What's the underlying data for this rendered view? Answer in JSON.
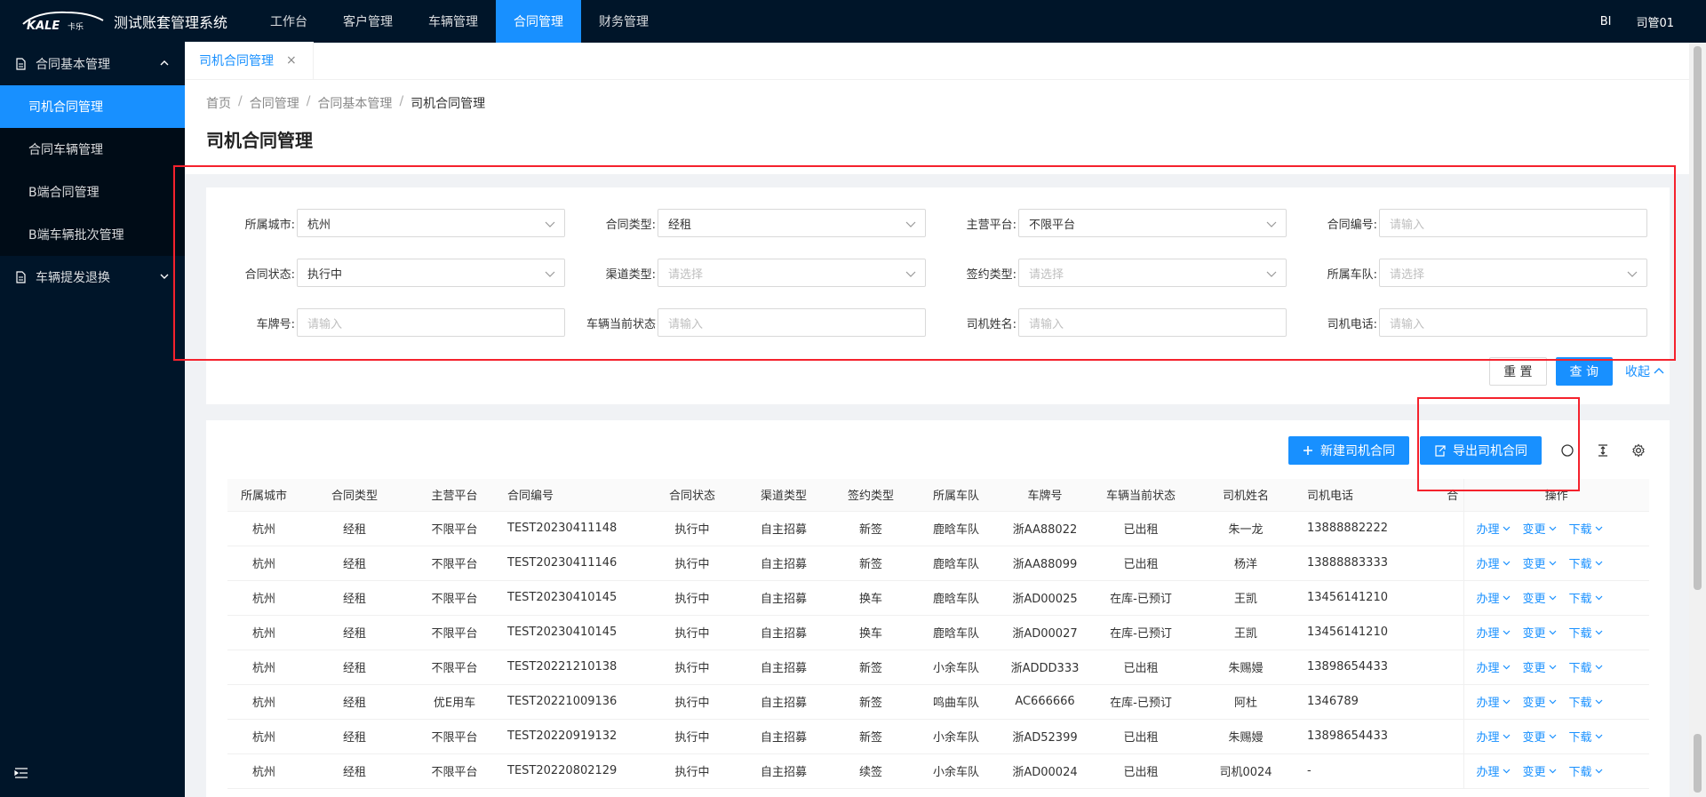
{
  "app": {
    "logo_text": "KALE卡乐",
    "title": "测试账套管理系统"
  },
  "topnav": [
    {
      "label": "工作台"
    },
    {
      "label": "客户管理"
    },
    {
      "label": "车辆管理"
    },
    {
      "label": "合同管理",
      "active": true
    },
    {
      "label": "财务管理"
    }
  ],
  "top_right": {
    "bi": "BI",
    "user": "司管01"
  },
  "sidebar": {
    "group1": "合同基本管理",
    "items": [
      "司机合同管理",
      "合同车辆管理",
      "B端合同管理",
      "B端车辆批次管理"
    ],
    "group2": "车辆提发退换"
  },
  "tab": {
    "label": "司机合同管理",
    "close": "×"
  },
  "breadcrumb": [
    "首页",
    "合同管理",
    "合同基本管理",
    "司机合同管理"
  ],
  "page_title": "司机合同管理",
  "filters": {
    "city": {
      "label": "所属城市:",
      "value": "杭州"
    },
    "contract_type": {
      "label": "合同类型:",
      "value": "经租"
    },
    "platform": {
      "label": "主营平台:",
      "value": "不限平台"
    },
    "contract_no": {
      "label": "合同编号:",
      "placeholder": "请输入"
    },
    "contract_status": {
      "label": "合同状态:",
      "value": "执行中"
    },
    "channel_type": {
      "label": "渠道类型:",
      "placeholder": "请选择"
    },
    "sign_type": {
      "label": "签约类型:",
      "placeholder": "请选择"
    },
    "fleet": {
      "label": "所属车队:",
      "placeholder": "请选择"
    },
    "plate": {
      "label": "车牌号:",
      "placeholder": "请输入"
    },
    "vehicle_status": {
      "label": "车辆当前状态",
      "placeholder": "请输入"
    },
    "driver_name": {
      "label": "司机姓名:",
      "placeholder": "请输入"
    },
    "driver_phone": {
      "label": "司机电话:",
      "placeholder": "请输入"
    }
  },
  "buttons": {
    "reset": "重 置",
    "query": "查 询",
    "collapse": "收起"
  },
  "toolbar": {
    "new": "新建司机合同",
    "export": "导出司机合同"
  },
  "table": {
    "headers": [
      "所属城市",
      "合同类型",
      "主营平台",
      "合同编号",
      "合同状态",
      "渠道类型",
      "签约类型",
      "所属车队",
      "车牌号",
      "车辆当前状态",
      "司机姓名",
      "司机电话",
      "合",
      "操作"
    ],
    "ops": [
      "办理",
      "变更",
      "下载"
    ],
    "rows": [
      [
        "杭州",
        "经租",
        "不限平台",
        "TEST20230411148",
        "执行中",
        "自主招募",
        "新签",
        "鹿晗车队",
        "浙AA88022",
        "已出租",
        "朱一龙",
        "13888882222"
      ],
      [
        "杭州",
        "经租",
        "不限平台",
        "TEST20230411146",
        "执行中",
        "自主招募",
        "新签",
        "鹿晗车队",
        "浙AA88099",
        "已出租",
        "杨洋",
        "13888883333"
      ],
      [
        "杭州",
        "经租",
        "不限平台",
        "TEST20230410145",
        "执行中",
        "自主招募",
        "换车",
        "鹿晗车队",
        "浙AD00025",
        "在库-已预订",
        "王凯",
        "13456141210"
      ],
      [
        "杭州",
        "经租",
        "不限平台",
        "TEST20230410145",
        "执行中",
        "自主招募",
        "换车",
        "鹿晗车队",
        "浙AD00027",
        "在库-已预订",
        "王凯",
        "13456141210"
      ],
      [
        "杭州",
        "经租",
        "不限平台",
        "TEST20221210138",
        "执行中",
        "自主招募",
        "新签",
        "小余车队",
        "浙ADDD333",
        "已出租",
        "朱赐嫚",
        "13898654433"
      ],
      [
        "杭州",
        "经租",
        "优E用车",
        "TEST20221009136",
        "执行中",
        "自主招募",
        "新签",
        "鸣曲车队",
        "AC666666",
        "在库-已预订",
        "阿杜",
        "1346789"
      ],
      [
        "杭州",
        "经租",
        "不限平台",
        "TEST20220919132",
        "执行中",
        "自主招募",
        "新签",
        "小余车队",
        "浙AD52399",
        "已出租",
        "朱赐嫚",
        "13898654433"
      ],
      [
        "杭州",
        "经租",
        "不限平台",
        "TEST20220802129",
        "执行中",
        "自主招募",
        "续签",
        "小余车队",
        "浙AD00024",
        "已出租",
        "司机0024",
        "-"
      ]
    ]
  },
  "colors": {
    "primary": "#1890ff",
    "sider": "#001529",
    "highlight": "#f5222d"
  }
}
